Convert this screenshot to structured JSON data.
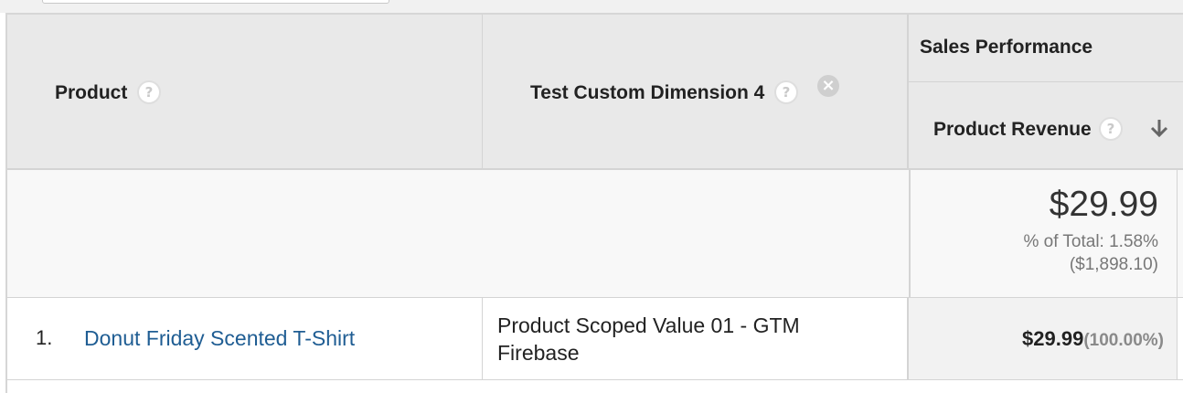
{
  "header": {
    "product_label": "Product",
    "dimension_label": "Test Custom Dimension 4",
    "group_label": "Sales Performance",
    "metric_label": "Product Revenue"
  },
  "icons": {
    "help": "help-icon",
    "remove": "close-icon",
    "sort": "arrow-down-icon",
    "help_glyph": "?",
    "remove_glyph": "×"
  },
  "summary": {
    "total": "$29.99",
    "percent_of_total": "% of Total: 1.58%",
    "grand_total": "($1,898.10)"
  },
  "rows": [
    {
      "index": "1.",
      "product": "Donut Friday Scented T-Shirt",
      "dimension_value": "Product Scoped Value 01 - GTM Firebase",
      "revenue": "$29.99",
      "revenue_share": "(100.00%)"
    }
  ],
  "colors": {
    "link": "#1f5d93",
    "header_bg": "#e9e9e9",
    "summary_bg": "#f8f8f8",
    "border": "#d4d4d4"
  }
}
